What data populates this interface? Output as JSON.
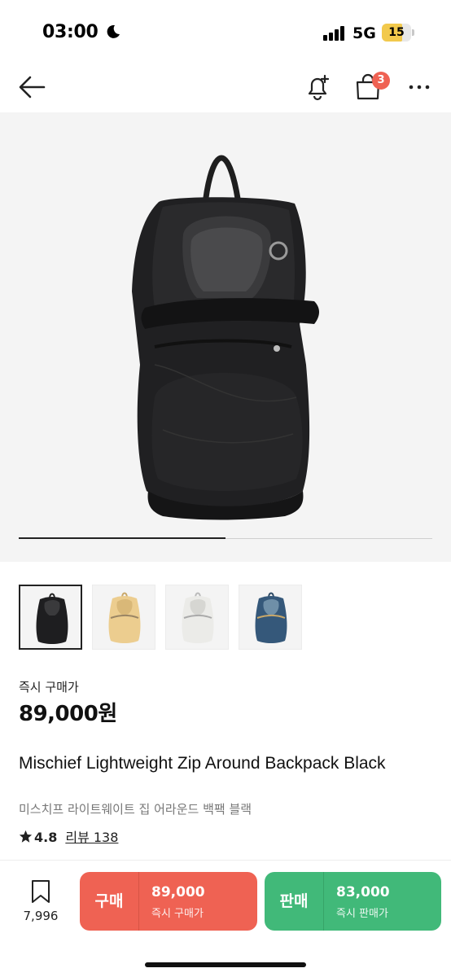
{
  "status_bar": {
    "time": "03:00",
    "network": "5G",
    "battery": "15"
  },
  "nav": {
    "cart_count": "3"
  },
  "gallery": {
    "current_index": 1,
    "total": 2,
    "thumbnails": [
      {
        "color": "black",
        "selected": true
      },
      {
        "color": "yellow",
        "selected": false
      },
      {
        "color": "white",
        "selected": false
      },
      {
        "color": "blue",
        "selected": false
      }
    ]
  },
  "price": {
    "label": "즉시 구매가",
    "value": "89,000원"
  },
  "product": {
    "title_en": "Mischief Lightweight Zip Around Backpack Black",
    "title_ko": "미스치프 라이트웨이트 집 어라운드 백팩 블랙",
    "rating": "4.8",
    "reviews": "리뷰 138"
  },
  "bottom_bar": {
    "bookmark_count": "7,996",
    "buy": {
      "label": "구매",
      "price": "89,000",
      "sub": "즉시 구매가",
      "color": "#ef6253"
    },
    "sell": {
      "label": "판매",
      "price": "83,000",
      "sub": "즉시 판매가",
      "color": "#41b979"
    }
  }
}
